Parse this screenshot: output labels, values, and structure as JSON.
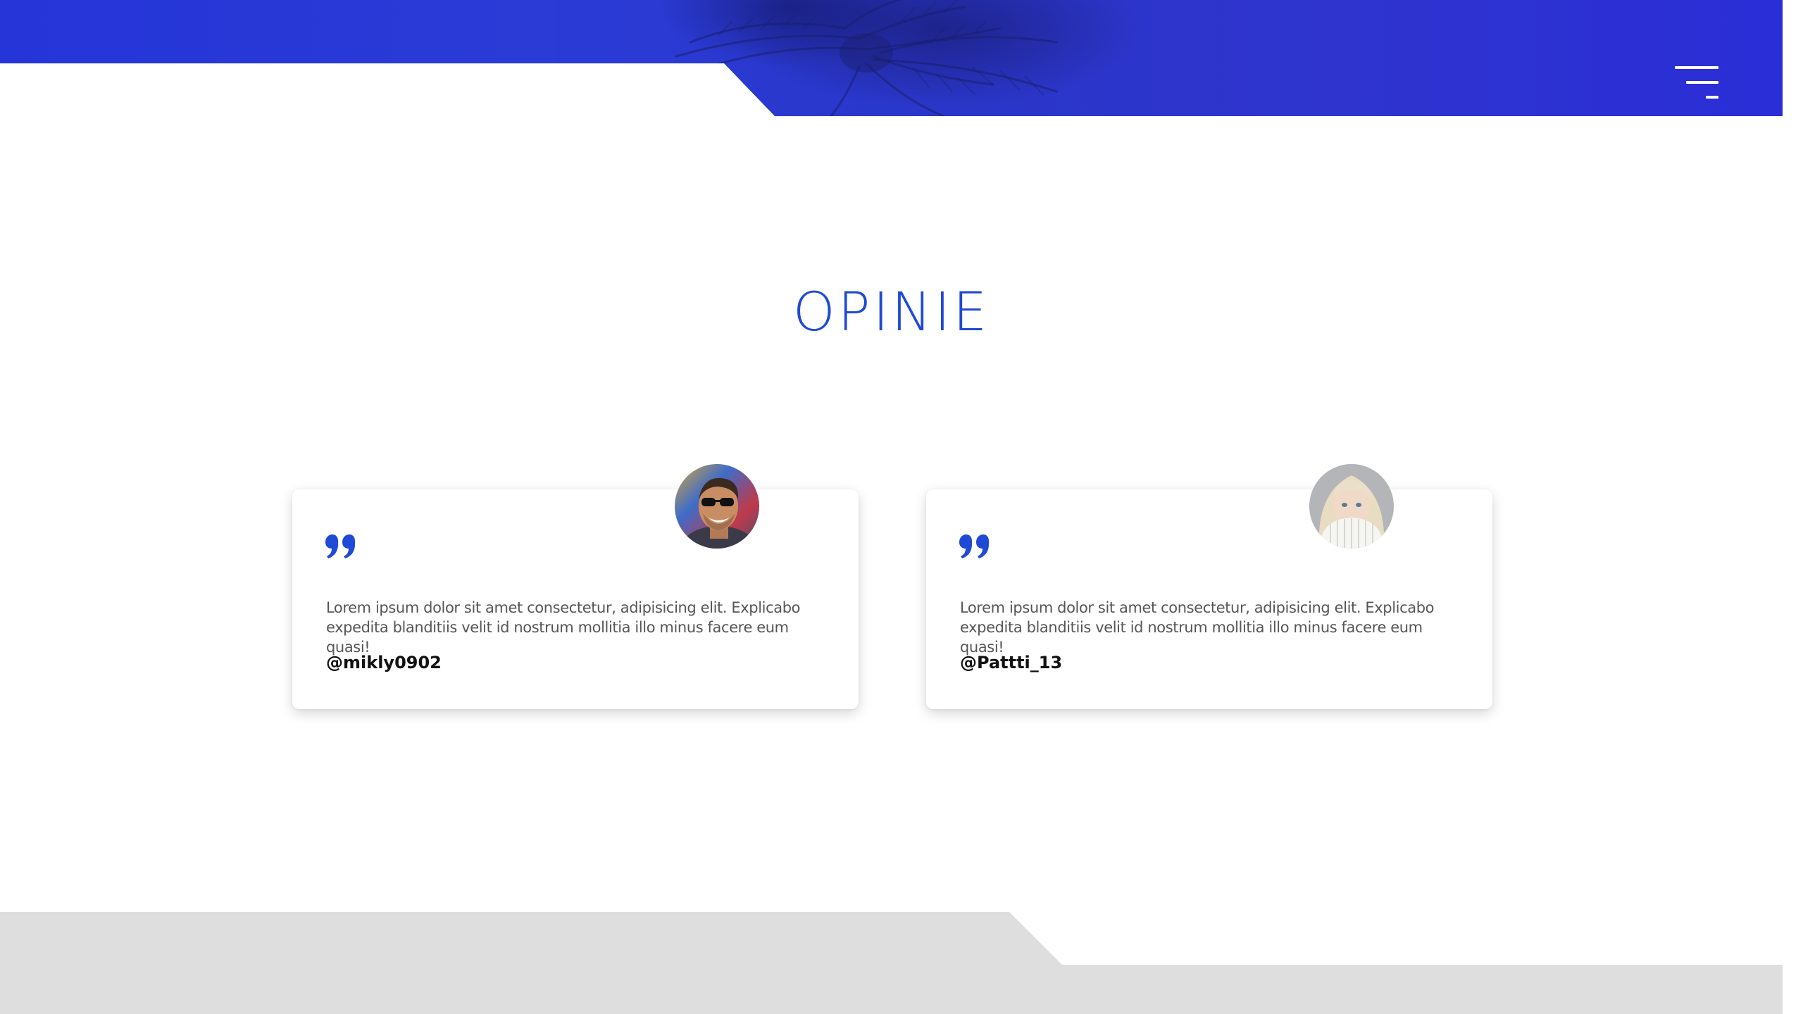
{
  "header": {
    "menu_icon": "hamburger-menu-icon"
  },
  "section": {
    "title": "OPINIE"
  },
  "testimonials": [
    {
      "text": "Lorem ipsum dolor sit amet consectetur, adipisicing elit. Explicabo expedita blanditiis velit id nostrum mollitia illo minus facere eum quasi!",
      "handle": "@mikly0902",
      "avatar": "avatar-man-sunglasses"
    },
    {
      "text": "Lorem ipsum dolor sit amet consectetur, adipisicing elit. Explicabo expedita blanditiis velit id nostrum mollitia illo minus facere eum quasi!",
      "handle": "@Pattti_13",
      "avatar": "avatar-woman-sweater"
    }
  ],
  "colors": {
    "accent": "#1f4ad6",
    "hero": "#2a36d0",
    "footer": "#dedede",
    "text": "#565656"
  }
}
